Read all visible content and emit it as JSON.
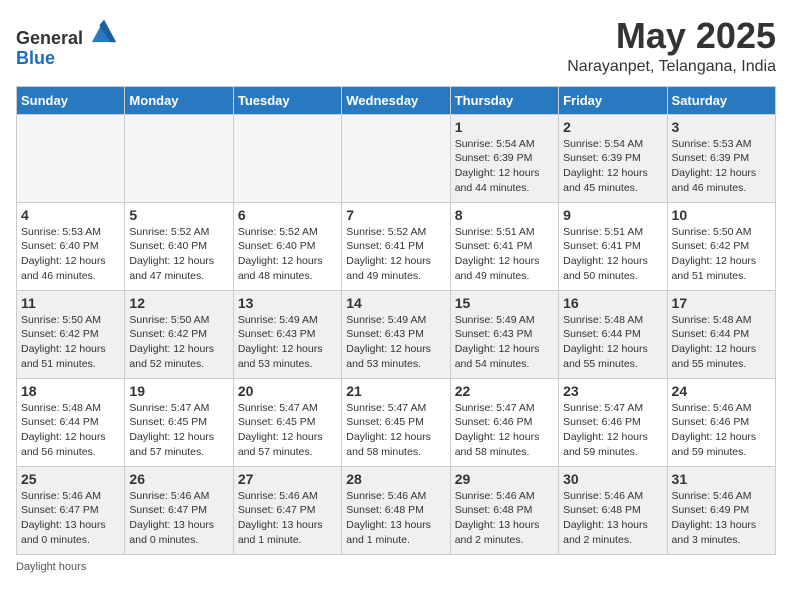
{
  "header": {
    "logo_general": "General",
    "logo_blue": "Blue",
    "month_title": "May 2025",
    "location": "Narayanpet, Telangana, India"
  },
  "days_of_week": [
    "Sunday",
    "Monday",
    "Tuesday",
    "Wednesday",
    "Thursday",
    "Friday",
    "Saturday"
  ],
  "weeks": [
    [
      {
        "day": "",
        "info": ""
      },
      {
        "day": "",
        "info": ""
      },
      {
        "day": "",
        "info": ""
      },
      {
        "day": "",
        "info": ""
      },
      {
        "day": "1",
        "info": "Sunrise: 5:54 AM\nSunset: 6:39 PM\nDaylight: 12 hours\nand 44 minutes."
      },
      {
        "day": "2",
        "info": "Sunrise: 5:54 AM\nSunset: 6:39 PM\nDaylight: 12 hours\nand 45 minutes."
      },
      {
        "day": "3",
        "info": "Sunrise: 5:53 AM\nSunset: 6:39 PM\nDaylight: 12 hours\nand 46 minutes."
      }
    ],
    [
      {
        "day": "4",
        "info": "Sunrise: 5:53 AM\nSunset: 6:40 PM\nDaylight: 12 hours\nand 46 minutes."
      },
      {
        "day": "5",
        "info": "Sunrise: 5:52 AM\nSunset: 6:40 PM\nDaylight: 12 hours\nand 47 minutes."
      },
      {
        "day": "6",
        "info": "Sunrise: 5:52 AM\nSunset: 6:40 PM\nDaylight: 12 hours\nand 48 minutes."
      },
      {
        "day": "7",
        "info": "Sunrise: 5:52 AM\nSunset: 6:41 PM\nDaylight: 12 hours\nand 49 minutes."
      },
      {
        "day": "8",
        "info": "Sunrise: 5:51 AM\nSunset: 6:41 PM\nDaylight: 12 hours\nand 49 minutes."
      },
      {
        "day": "9",
        "info": "Sunrise: 5:51 AM\nSunset: 6:41 PM\nDaylight: 12 hours\nand 50 minutes."
      },
      {
        "day": "10",
        "info": "Sunrise: 5:50 AM\nSunset: 6:42 PM\nDaylight: 12 hours\nand 51 minutes."
      }
    ],
    [
      {
        "day": "11",
        "info": "Sunrise: 5:50 AM\nSunset: 6:42 PM\nDaylight: 12 hours\nand 51 minutes."
      },
      {
        "day": "12",
        "info": "Sunrise: 5:50 AM\nSunset: 6:42 PM\nDaylight: 12 hours\nand 52 minutes."
      },
      {
        "day": "13",
        "info": "Sunrise: 5:49 AM\nSunset: 6:43 PM\nDaylight: 12 hours\nand 53 minutes."
      },
      {
        "day": "14",
        "info": "Sunrise: 5:49 AM\nSunset: 6:43 PM\nDaylight: 12 hours\nand 53 minutes."
      },
      {
        "day": "15",
        "info": "Sunrise: 5:49 AM\nSunset: 6:43 PM\nDaylight: 12 hours\nand 54 minutes."
      },
      {
        "day": "16",
        "info": "Sunrise: 5:48 AM\nSunset: 6:44 PM\nDaylight: 12 hours\nand 55 minutes."
      },
      {
        "day": "17",
        "info": "Sunrise: 5:48 AM\nSunset: 6:44 PM\nDaylight: 12 hours\nand 55 minutes."
      }
    ],
    [
      {
        "day": "18",
        "info": "Sunrise: 5:48 AM\nSunset: 6:44 PM\nDaylight: 12 hours\nand 56 minutes."
      },
      {
        "day": "19",
        "info": "Sunrise: 5:47 AM\nSunset: 6:45 PM\nDaylight: 12 hours\nand 57 minutes."
      },
      {
        "day": "20",
        "info": "Sunrise: 5:47 AM\nSunset: 6:45 PM\nDaylight: 12 hours\nand 57 minutes."
      },
      {
        "day": "21",
        "info": "Sunrise: 5:47 AM\nSunset: 6:45 PM\nDaylight: 12 hours\nand 58 minutes."
      },
      {
        "day": "22",
        "info": "Sunrise: 5:47 AM\nSunset: 6:46 PM\nDaylight: 12 hours\nand 58 minutes."
      },
      {
        "day": "23",
        "info": "Sunrise: 5:47 AM\nSunset: 6:46 PM\nDaylight: 12 hours\nand 59 minutes."
      },
      {
        "day": "24",
        "info": "Sunrise: 5:46 AM\nSunset: 6:46 PM\nDaylight: 12 hours\nand 59 minutes."
      }
    ],
    [
      {
        "day": "25",
        "info": "Sunrise: 5:46 AM\nSunset: 6:47 PM\nDaylight: 13 hours\nand 0 minutes."
      },
      {
        "day": "26",
        "info": "Sunrise: 5:46 AM\nSunset: 6:47 PM\nDaylight: 13 hours\nand 0 minutes."
      },
      {
        "day": "27",
        "info": "Sunrise: 5:46 AM\nSunset: 6:47 PM\nDaylight: 13 hours\nand 1 minute."
      },
      {
        "day": "28",
        "info": "Sunrise: 5:46 AM\nSunset: 6:48 PM\nDaylight: 13 hours\nand 1 minute."
      },
      {
        "day": "29",
        "info": "Sunrise: 5:46 AM\nSunset: 6:48 PM\nDaylight: 13 hours\nand 2 minutes."
      },
      {
        "day": "30",
        "info": "Sunrise: 5:46 AM\nSunset: 6:48 PM\nDaylight: 13 hours\nand 2 minutes."
      },
      {
        "day": "31",
        "info": "Sunrise: 5:46 AM\nSunset: 6:49 PM\nDaylight: 13 hours\nand 3 minutes."
      }
    ]
  ],
  "footer": {
    "note": "Daylight hours"
  }
}
